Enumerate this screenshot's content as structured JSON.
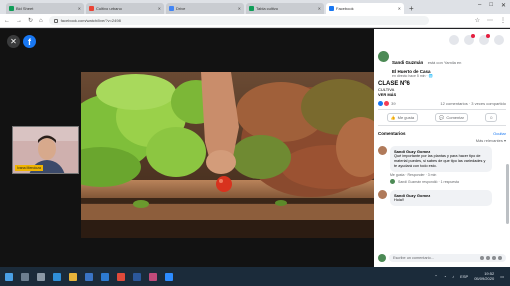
{
  "browser": {
    "tabs": [
      {
        "title": "Bid Sheet",
        "color": "#0f9d58"
      },
      {
        "title": "Cultivo urbano",
        "color": "#ea4335"
      },
      {
        "title": "Drive",
        "color": "#4285f4"
      },
      {
        "title": "Tabla cultivo",
        "color": "#0f9d58"
      },
      {
        "title": "Facebook",
        "color": "#1877f2"
      }
    ],
    "new_tab": "+",
    "url": "facebook.com/watch/live/?v=2498",
    "win_min": "–",
    "win_max": "□",
    "win_close": "✕",
    "nav_back": "←",
    "nav_forward": "→",
    "nav_reload": "↻",
    "nav_home": "⌂",
    "tb_star": "☆",
    "tb_ext": "⋯",
    "tb_menu": "⋮"
  },
  "stage": {
    "close_glyph": "✕",
    "fb_glyph": "f",
    "camera_label": "Ivana Mendoza"
  },
  "panel": {
    "author": "Sandi Guzmán",
    "author_suffix": "está con Yamila en",
    "page_name": "El Huerto de Casa",
    "meta": "en directo hace 5 min · 🌐",
    "post_title": "CLASE Nº6",
    "post_line1": "CULTIVA",
    "post_line2": "VER MÁS",
    "reactions_count": "39",
    "comments_count": "12 comentarios · 3 veces compartido",
    "action_like": "Me gusta",
    "action_comment": "Comentar",
    "comments_header": "Comentarios",
    "comments_link": "Ocultar",
    "sort_label": "Más relevantes ▾",
    "comments": [
      {
        "name": "Sandi Guzy Gomez",
        "text": "Qué importante por las plantas y para hacer tipo de material puedes, si sabes de que tipo las variedades y te ayudará con todo esto.",
        "actions": "Me gusta · Responder · 3 min",
        "reply": "Sandi Guzmán respondió · 1 respuesta"
      },
      {
        "name": "Sandi Guzy Gomez",
        "text": "Hola!!",
        "actions": "Me gusta · Responder · 1 min",
        "reply": ""
      }
    ],
    "composer_placeholder": "Escribe un comentario..."
  },
  "taskbar": {
    "icons": [
      "windows-icon",
      "search-icon",
      "task-view-icon",
      "edge-icon",
      "explorer-icon",
      "store-icon",
      "mail-icon",
      "chrome-icon",
      "word-icon",
      "photos-icon",
      "zoom-icon"
    ],
    "time": "19:52",
    "date": "05/09/2020",
    "lang": "ESP"
  }
}
